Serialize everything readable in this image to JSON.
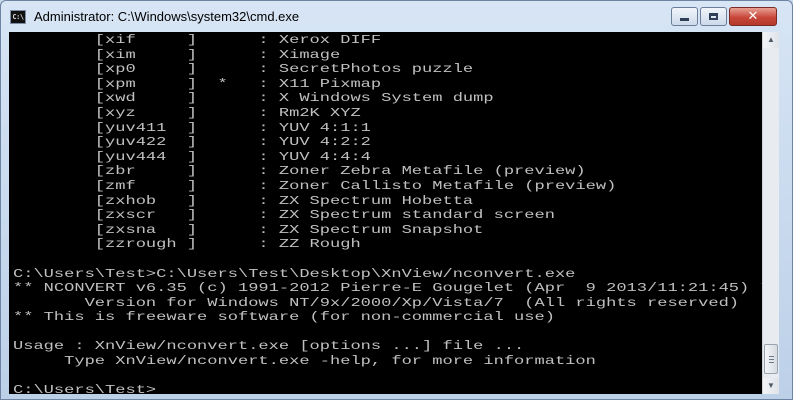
{
  "window": {
    "title": "Administrator: C:\\Windows\\system32\\cmd.exe",
    "icon_glyph": "C:\\",
    "icon_name": "cmd-icon",
    "controls": {
      "minimize": "minimize-icon",
      "maximize": "maximize-icon",
      "close": "close-icon",
      "close_glyph": "✕"
    }
  },
  "colors": {
    "console_background": "#000000",
    "console_text": "#c0c0c0",
    "close_button": "#c8473a"
  },
  "console": {
    "lines": [
      "        [xif     ]      : Xerox DIFF",
      "        [xim     ]      : Ximage",
      "        [xp0     ]      : SecretPhotos puzzle",
      "        [xpm     ]  *   : X11 Pixmap",
      "        [xwd     ]      : X Windows System dump",
      "        [xyz     ]      : Rm2K XYZ",
      "        [yuv411  ]      : YUV 4:1:1",
      "        [yuv422  ]      : YUV 4:2:2",
      "        [yuv444  ]      : YUV 4:4:4",
      "        [zbr     ]      : Zoner Zebra Metafile (preview)",
      "        [zmf     ]      : Zoner Callisto Metafile (preview)",
      "        [zxhob   ]      : ZX Spectrum Hobetta",
      "        [zxscr   ]      : ZX Spectrum standard screen",
      "        [zxsna   ]      : ZX Spectrum Snapshot",
      "        [zzrough ]      : ZZ Rough",
      "",
      "C:\\Users\\Test>C:\\Users\\Test\\Desktop\\XnView/nconvert.exe",
      "** NCONVERT v6.35 (c) 1991-2012 Pierre-E Gougelet (Apr  9 2013/11:21:45) **",
      "       Version for Windows NT/9x/2000/Xp/Vista/7  (All rights reserved)",
      "** This is freeware software (for non-commercial use)",
      "",
      "Usage : XnView/nconvert.exe [options ...] file ...",
      "     Type XnView/nconvert.exe -help, for more information",
      "",
      "C:\\Users\\Test>"
    ]
  },
  "scrollbar": {
    "up_arrow": "▲",
    "down_arrow": "▼",
    "position": 0.97
  }
}
